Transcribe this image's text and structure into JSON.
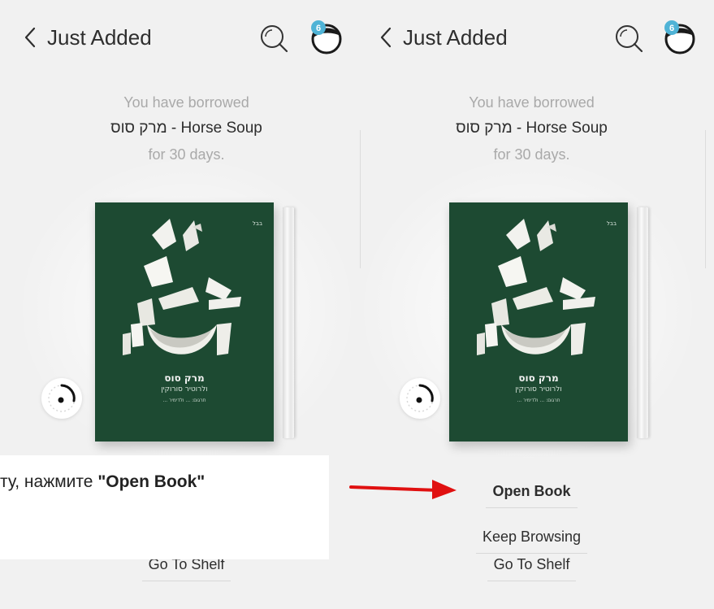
{
  "left_panel": {
    "header": {
      "title": "Just Added",
      "avatar_badge": "6"
    },
    "borrow_message": {
      "line1": "You have borrowed",
      "line2": "מרק סוס - Horse Soup",
      "line3": "for 30 days."
    },
    "book": {
      "cover_title": "מרק סוס",
      "cover_subtitle": "ולרוטיר סורוקין",
      "cover_author": "תרגום: ... ולדימיר ...",
      "cover_logo": "בבל"
    },
    "actions": {
      "go_to_shelf": "Go To Shelf"
    }
  },
  "right_panel": {
    "header": {
      "title": "Just Added",
      "avatar_badge": "6"
    },
    "borrow_message": {
      "line1": "You have borrowed",
      "line2": "מרק סוס - Horse Soup",
      "line3": "for 30 days."
    },
    "book": {
      "cover_title": "מרק סוס",
      "cover_subtitle": "ולרוטיר סורוקין",
      "cover_author": "תרגום: ... ולדימיר ...",
      "cover_logo": "בבל"
    },
    "actions": {
      "open_book": "Open Book",
      "keep_browsing": "Keep Browsing",
      "go_to_shelf": "Go To Shelf"
    }
  },
  "caption": {
    "prefix": "ту, нажмите ",
    "highlight": "\"Open Book\""
  },
  "icons": {
    "back": "chevron-left-icon",
    "search": "search-icon",
    "avatar": "user-avatar-icon",
    "spinner": "loading-spinner-icon",
    "arrow": "red-arrow-icon"
  },
  "colors": {
    "background": "#f1f1f1",
    "book_cover": "#1d4a32",
    "avatar_badge": "#4fb3d6",
    "arrow": "#e01010",
    "text_primary": "#2d2d2d",
    "text_secondary": "#a9a9a9"
  }
}
